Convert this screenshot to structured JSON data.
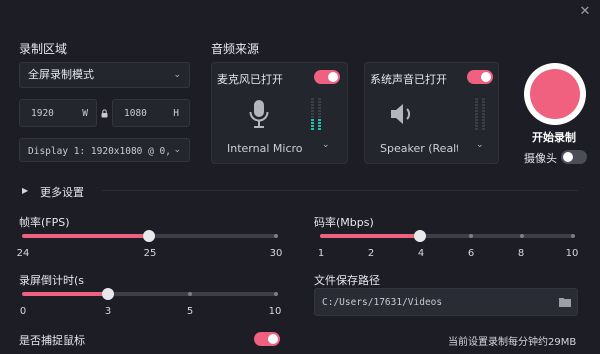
{
  "window": {
    "close_icon": "close-icon"
  },
  "record_area": {
    "title": "录制区域",
    "mode": "全屏录制模式",
    "width": "1920",
    "width_unit": "W",
    "height": "1080",
    "height_unit": "H",
    "display": "Display 1: 1920x1080 @ 0,"
  },
  "audio": {
    "title": "音频来源",
    "mic": {
      "label": "麦克风已打开",
      "enabled": true,
      "device": "Internal Microp"
    },
    "system": {
      "label": "系统声音已打开",
      "enabled": true,
      "device": "Speaker (Realt"
    }
  },
  "record": {
    "label": "开始录制",
    "camera_label": "摄像头",
    "camera_enabled": false,
    "accent": "#f0607f"
  },
  "more_settings": "更多设置",
  "fps": {
    "label": "帧率(FPS)",
    "ticks": [
      "24",
      "25",
      "30"
    ],
    "value": 25
  },
  "bitrate": {
    "label": "码率(Mbps)",
    "ticks": [
      "1",
      "2",
      "4",
      "6",
      "8",
      "10"
    ],
    "value": 4
  },
  "countdown": {
    "label": "录屏倒计时(s",
    "ticks": [
      "0",
      "3",
      "5",
      "10"
    ],
    "value": 3
  },
  "save_path": {
    "label": "文件保存路径",
    "value": "C:/Users/17631/Videos"
  },
  "capture_mouse": {
    "label": "是否捕捉鼠标",
    "enabled": true
  },
  "estimate": "当前设置录制每分钟约29MB"
}
